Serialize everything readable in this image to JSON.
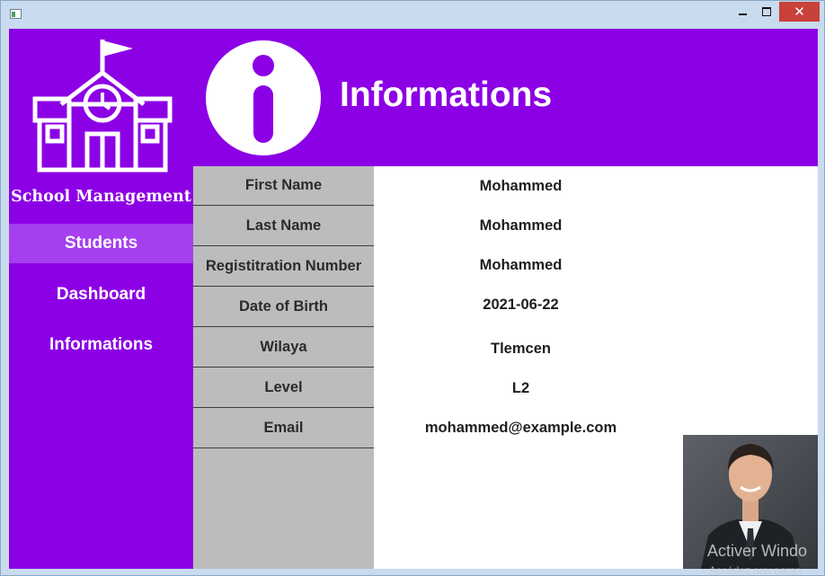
{
  "window": {
    "close_glyph": "✕"
  },
  "sidebar": {
    "app_title": "School Management",
    "items": [
      {
        "label": "Students",
        "active": true
      },
      {
        "label": "Dashboard",
        "active": false
      },
      {
        "label": "Informations",
        "active": false
      }
    ]
  },
  "header": {
    "title": "Informations",
    "icon": "info-icon"
  },
  "details": {
    "rows": [
      {
        "label": "First Name",
        "value": "Mohammed"
      },
      {
        "label": "Last Name",
        "value": "Mohammed"
      },
      {
        "label": "Registitration Number",
        "value": "Mohammed"
      },
      {
        "label": "Date of Birth",
        "value": "2021-06-22"
      },
      {
        "label": "Wilaya",
        "value": "Tlemcen"
      },
      {
        "label": "Level",
        "value": "L2"
      },
      {
        "label": "Email",
        "value": "mohammed@example.com"
      }
    ]
  },
  "overlay": {
    "watermark": "Activer Windo",
    "watermark_sub": "Accédez aux paran"
  },
  "colors": {
    "accent": "#8c00e5",
    "active_nav": "#a53ff0",
    "label_column": "#bcbcbc",
    "close_button": "#c8413a"
  }
}
